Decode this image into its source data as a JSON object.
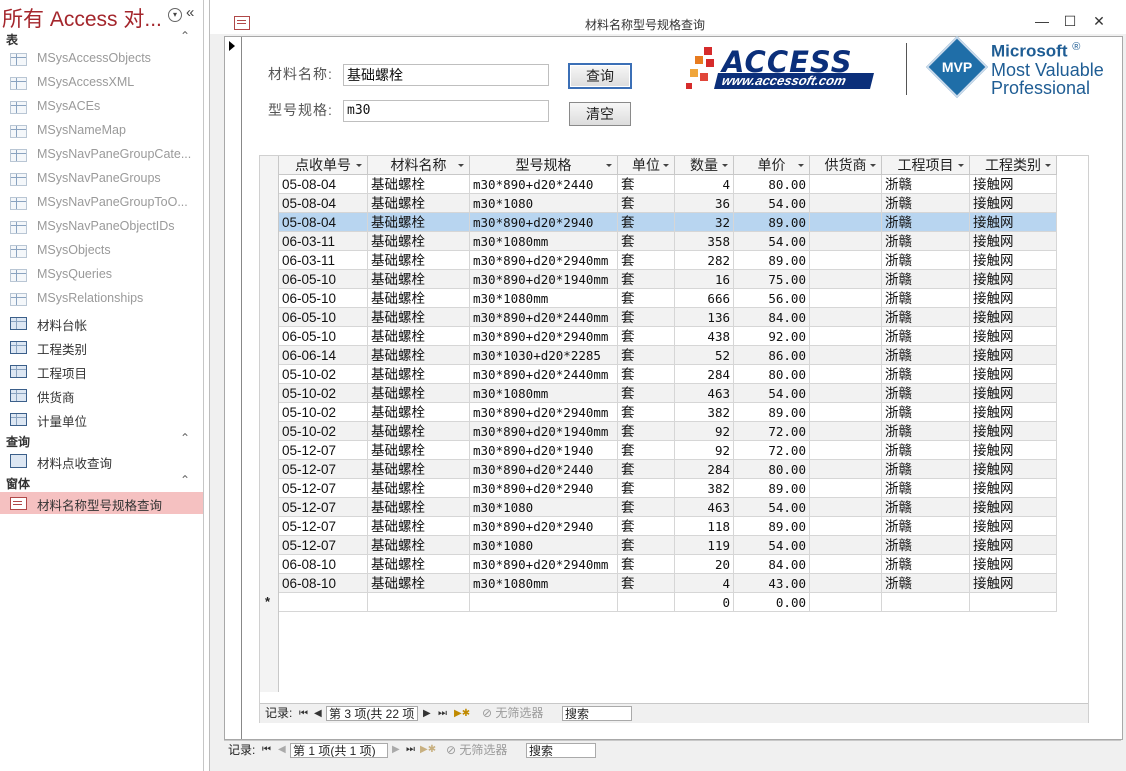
{
  "nav": {
    "title": "所有 Access 对...",
    "groups": [
      {
        "label": "表"
      },
      {
        "label": "查询"
      },
      {
        "label": "窗体"
      }
    ],
    "tables": [
      {
        "label": "MSysAccessObjects",
        "kind": "sys"
      },
      {
        "label": "MSysAccessXML",
        "kind": "sys"
      },
      {
        "label": "MSysACEs",
        "kind": "sys"
      },
      {
        "label": "MSysNameMap",
        "kind": "sys"
      },
      {
        "label": "MSysNavPaneGroupCate...",
        "kind": "sys"
      },
      {
        "label": "MSysNavPaneGroups",
        "kind": "sys"
      },
      {
        "label": "MSysNavPaneGroupToO...",
        "kind": "sys"
      },
      {
        "label": "MSysNavPaneObjectIDs",
        "kind": "sys"
      },
      {
        "label": "MSysObjects",
        "kind": "sys"
      },
      {
        "label": "MSysQueries",
        "kind": "sys"
      },
      {
        "label": "MSysRelationships",
        "kind": "sys"
      },
      {
        "label": "材料台帐",
        "kind": "user"
      },
      {
        "label": "工程类别",
        "kind": "user"
      },
      {
        "label": "工程项目",
        "kind": "user"
      },
      {
        "label": "供货商",
        "kind": "user"
      },
      {
        "label": "计量单位",
        "kind": "user"
      }
    ],
    "queries": [
      {
        "label": "材料点收查询"
      }
    ],
    "forms": [
      {
        "label": "材料名称型号规格查询"
      }
    ]
  },
  "window": {
    "title": "材料名称型号规格查询",
    "min": "—",
    "max": "☐",
    "close": "✕"
  },
  "form": {
    "name_label": "材料名称:",
    "name_value": "基础螺栓",
    "spec_label": "型号规格:",
    "spec_value": "m30",
    "query_button": "查询",
    "clear_button": "清空"
  },
  "logos": {
    "access_word": "ACCESS",
    "access_url": "www.accessoft.com",
    "mvp_badge": "MVP",
    "mvp_line1": "Microsoft",
    "mvp_reg": "®",
    "mvp_line2": "Most Valuable",
    "mvp_line3": "Professional"
  },
  "grid": {
    "columns": [
      "点收单号",
      "材料名称",
      "型号规格",
      "单位",
      "数量",
      "单价",
      "供货商",
      "工程项目",
      "工程类别"
    ],
    "rows": [
      [
        "05-08-04",
        "基础螺栓",
        "m30*890+d20*2440",
        "套",
        "4",
        "80.00",
        "",
        "浙赣",
        "接触网"
      ],
      [
        "05-08-04",
        "基础螺栓",
        "m30*1080",
        "套",
        "36",
        "54.00",
        "",
        "浙赣",
        "接触网"
      ],
      [
        "05-08-04",
        "基础螺栓",
        "m30*890+d20*2940",
        "套",
        "32",
        "89.00",
        "",
        "浙赣",
        "接触网"
      ],
      [
        "06-03-11",
        "基础螺栓",
        "m30*1080mm",
        "套",
        "358",
        "54.00",
        "",
        "浙赣",
        "接触网"
      ],
      [
        "06-03-11",
        "基础螺栓",
        "m30*890+d20*2940mm",
        "套",
        "282",
        "89.00",
        "",
        "浙赣",
        "接触网"
      ],
      [
        "06-05-10",
        "基础螺栓",
        "m30*890+d20*1940mm",
        "套",
        "16",
        "75.00",
        "",
        "浙赣",
        "接触网"
      ],
      [
        "06-05-10",
        "基础螺栓",
        "m30*1080mm",
        "套",
        "666",
        "56.00",
        "",
        "浙赣",
        "接触网"
      ],
      [
        "06-05-10",
        "基础螺栓",
        "m30*890+d20*2440mm",
        "套",
        "136",
        "84.00",
        "",
        "浙赣",
        "接触网"
      ],
      [
        "06-05-10",
        "基础螺栓",
        "m30*890+d20*2940mm",
        "套",
        "438",
        "92.00",
        "",
        "浙赣",
        "接触网"
      ],
      [
        "06-06-14",
        "基础螺栓",
        "m30*1030+d20*2285",
        "套",
        "52",
        "86.00",
        "",
        "浙赣",
        "接触网"
      ],
      [
        "05-10-02",
        "基础螺栓",
        "m30*890+d20*2440mm",
        "套",
        "284",
        "80.00",
        "",
        "浙赣",
        "接触网"
      ],
      [
        "05-10-02",
        "基础螺栓",
        "m30*1080mm",
        "套",
        "463",
        "54.00",
        "",
        "浙赣",
        "接触网"
      ],
      [
        "05-10-02",
        "基础螺栓",
        "m30*890+d20*2940mm",
        "套",
        "382",
        "89.00",
        "",
        "浙赣",
        "接触网"
      ],
      [
        "05-10-02",
        "基础螺栓",
        "m30*890+d20*1940mm",
        "套",
        "92",
        "72.00",
        "",
        "浙赣",
        "接触网"
      ],
      [
        "05-12-07",
        "基础螺栓",
        "m30*890+d20*1940",
        "套",
        "92",
        "72.00",
        "",
        "浙赣",
        "接触网"
      ],
      [
        "05-12-07",
        "基础螺栓",
        "m30*890+d20*2440",
        "套",
        "284",
        "80.00",
        "",
        "浙赣",
        "接触网"
      ],
      [
        "05-12-07",
        "基础螺栓",
        "m30*890+d20*2940",
        "套",
        "382",
        "89.00",
        "",
        "浙赣",
        "接触网"
      ],
      [
        "05-12-07",
        "基础螺栓",
        "m30*1080",
        "套",
        "463",
        "54.00",
        "",
        "浙赣",
        "接触网"
      ],
      [
        "05-12-07",
        "基础螺栓",
        "m30*890+d20*2940",
        "套",
        "118",
        "89.00",
        "",
        "浙赣",
        "接触网"
      ],
      [
        "05-12-07",
        "基础螺栓",
        "m30*1080",
        "套",
        "119",
        "54.00",
        "",
        "浙赣",
        "接触网"
      ],
      [
        "06-08-10",
        "基础螺栓",
        "m30*890+d20*2940mm",
        "套",
        "20",
        "84.00",
        "",
        "浙赣",
        "接触网"
      ],
      [
        "06-08-10",
        "基础螺栓",
        "m30*1080mm",
        "套",
        "4",
        "43.00",
        "",
        "浙赣",
        "接触网"
      ]
    ],
    "selected_row": 2,
    "new_row": {
      "marker": "*",
      "qty": "0",
      "price": "0.00"
    }
  },
  "subnav": {
    "label": "记录:",
    "position": "第 3 项(共 22 项",
    "filter": "无筛选器",
    "search": "搜索"
  },
  "mainnav": {
    "label": "记录:",
    "position": "第 1 项(共 1 项)",
    "filter": "无筛选器",
    "search": "搜索"
  },
  "colors": {
    "nav_title": "#a4262c",
    "selected_nav_item": "#f5c1c1",
    "selected_row": "#b8d5f0",
    "access_blue": "#0b2f7a",
    "mvp_blue": "#1f5d94"
  }
}
